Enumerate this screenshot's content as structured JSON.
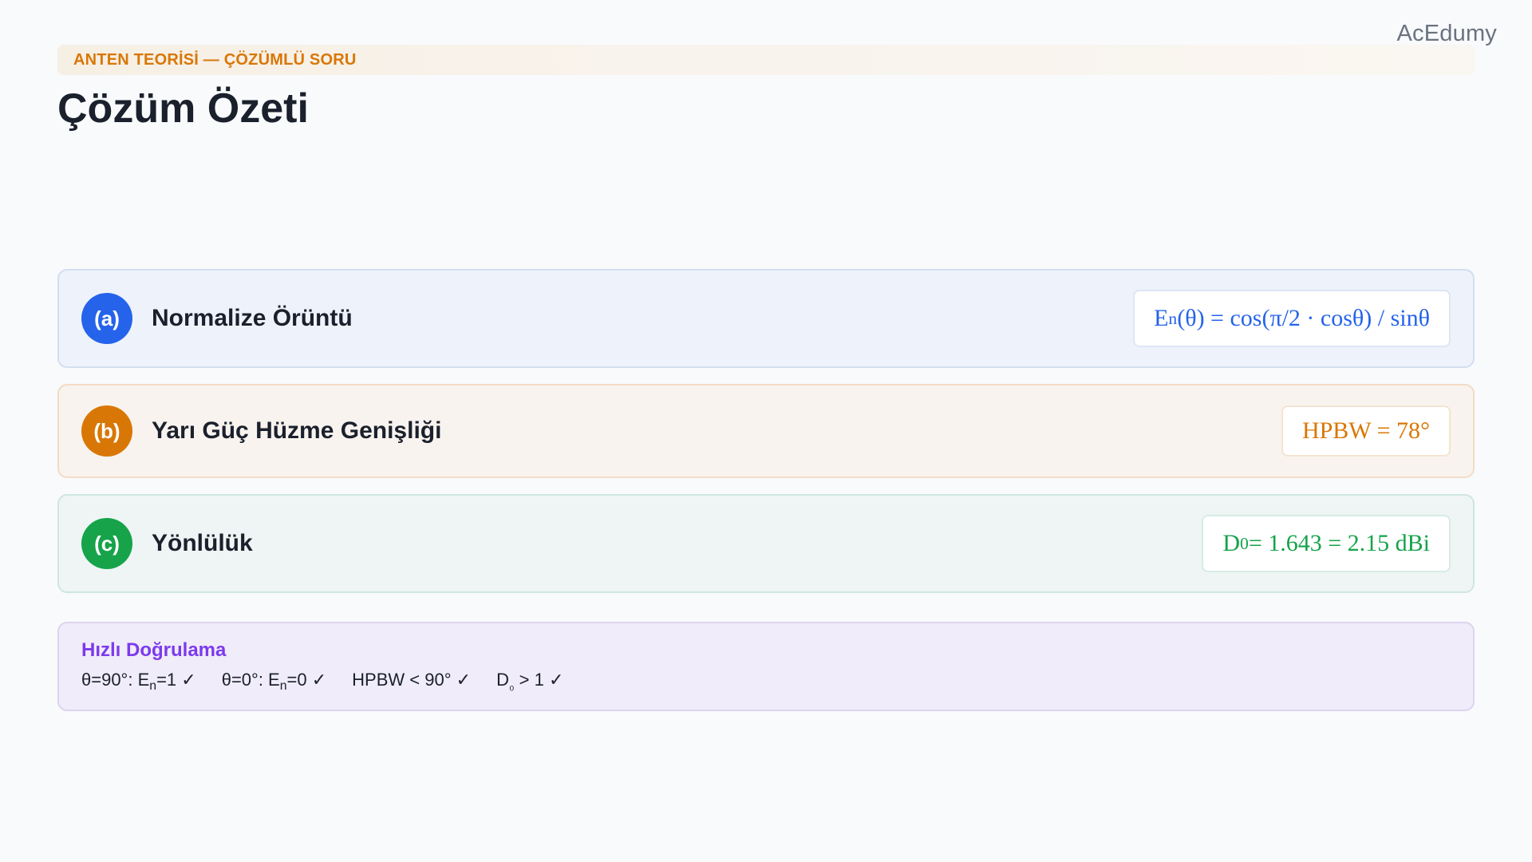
{
  "brand": "AcEdumy",
  "topic": "ANTEN TEORİSİ — ÇÖZÜMLÜ SORU",
  "title": "Çözüm Özeti",
  "cards": [
    {
      "badge": "(a)",
      "label": "Normalize Örüntü",
      "result": {
        "pre": "E",
        "sub": "n",
        "post": "(θ) = cos(π/2 · cosθ) / sinθ"
      },
      "accent": "#2563eb"
    },
    {
      "badge": "(b)",
      "label": "Yarı Güç Hüzme Genişliği",
      "result": {
        "text": "HPBW = 78°"
      },
      "accent": "#d97706"
    },
    {
      "badge": "(c)",
      "label": "Yönlülük",
      "result": {
        "pre": "D",
        "sub": "0",
        "post": " = 1.643 = 2.15 dBi"
      },
      "accent": "#16a34a"
    }
  ],
  "check": {
    "title": "Hızlı Doğrulama",
    "items": [
      {
        "pre": "θ=90°: E",
        "sub": "n",
        "post": "=1 ✓"
      },
      {
        "pre": "θ=0°: E",
        "sub": "n",
        "post": "=0 ✓"
      },
      {
        "text": "HPBW < 90° ✓"
      },
      {
        "pre": "D",
        "sub": "₀",
        "post": " > 1 ✓"
      }
    ],
    "accent": "#7c3aed"
  }
}
